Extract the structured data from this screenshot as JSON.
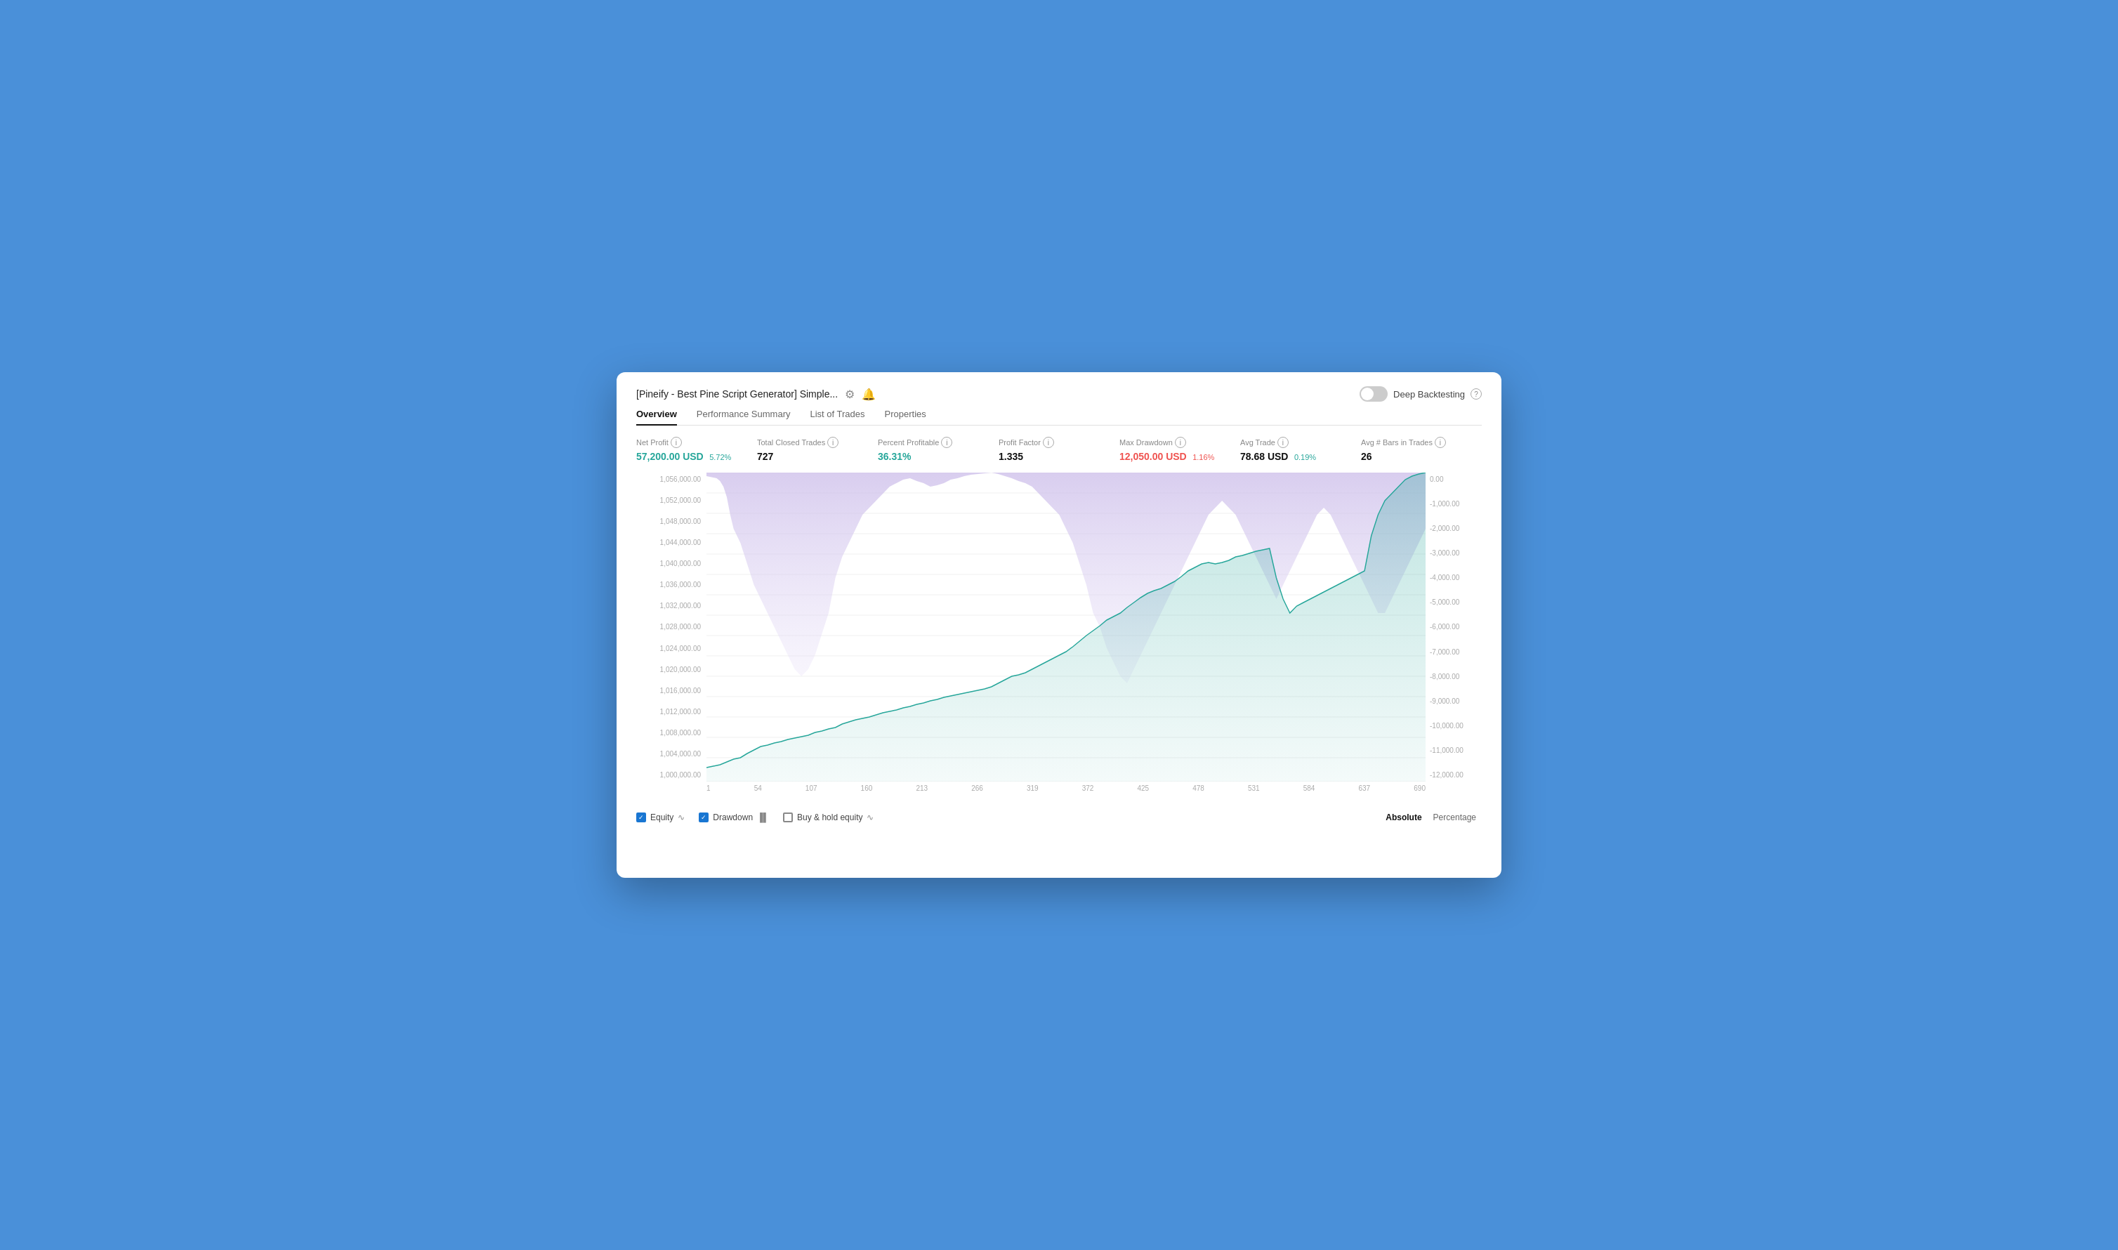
{
  "window": {
    "title": "[Pineify - Best Pine Script Generator] Simple...",
    "deep_backtesting": "Deep Backtesting"
  },
  "title_icons": [
    "settings-icon",
    "alarm-icon"
  ],
  "tabs": [
    {
      "label": "Overview",
      "active": true
    },
    {
      "label": "Performance Summary",
      "active": false
    },
    {
      "label": "List of Trades",
      "active": false
    },
    {
      "label": "Properties",
      "active": false
    }
  ],
  "metrics": [
    {
      "label": "Net Profit",
      "value": "57,200.00 USD",
      "sub": "5.72%",
      "value_class": "green",
      "sub_class": "green"
    },
    {
      "label": "Total Closed Trades",
      "value": "727",
      "sub": "",
      "value_class": "normal",
      "sub_class": ""
    },
    {
      "label": "Percent Profitable",
      "value": "36.31%",
      "value_class": "green",
      "sub": "",
      "sub_class": ""
    },
    {
      "label": "Profit Factor",
      "value": "1.335",
      "value_class": "normal",
      "sub": "",
      "sub_class": ""
    },
    {
      "label": "Max Drawdown",
      "value": "12,050.00 USD",
      "sub": "1.16%",
      "value_class": "red",
      "sub_class": "red"
    },
    {
      "label": "Avg Trade",
      "value": "78.68 USD",
      "sub": "0.19%",
      "value_class": "normal",
      "sub_class": "green"
    },
    {
      "label": "Avg # Bars in Trades",
      "value": "26",
      "value_class": "normal",
      "sub": "",
      "sub_class": ""
    }
  ],
  "chart": {
    "y_left": [
      "1,056,000.00",
      "1,052,000.00",
      "1,048,000.00",
      "1,044,000.00",
      "1,040,000.00",
      "1,036,000.00",
      "1,032,000.00",
      "1,028,000.00",
      "1,024,000.00",
      "1,020,000.00",
      "1,016,000.00",
      "1,012,000.00",
      "1,008,000.00",
      "1,004,000.00",
      "1,000,000.00"
    ],
    "y_right": [
      "0.00",
      "-1,000.00",
      "-2,000.00",
      "-3,000.00",
      "-4,000.00",
      "-5,000.00",
      "-6,000.00",
      "-7,000.00",
      "-8,000.00",
      "-9,000.00",
      "-10,000.00",
      "-11,000.00",
      "-12,000.00"
    ],
    "x_labels": [
      "1",
      "54",
      "107",
      "160",
      "213",
      "266",
      "319",
      "372",
      "425",
      "478",
      "531",
      "584",
      "637",
      "690"
    ]
  },
  "legend": {
    "equity": {
      "label": "Equity",
      "checked": true
    },
    "drawdown": {
      "label": "Drawdown",
      "checked": true
    },
    "buy_hold": {
      "label": "Buy & hold equity",
      "checked": false
    }
  },
  "view_modes": {
    "absolute": "Absolute",
    "percentage": "Percentage",
    "active": "absolute"
  }
}
